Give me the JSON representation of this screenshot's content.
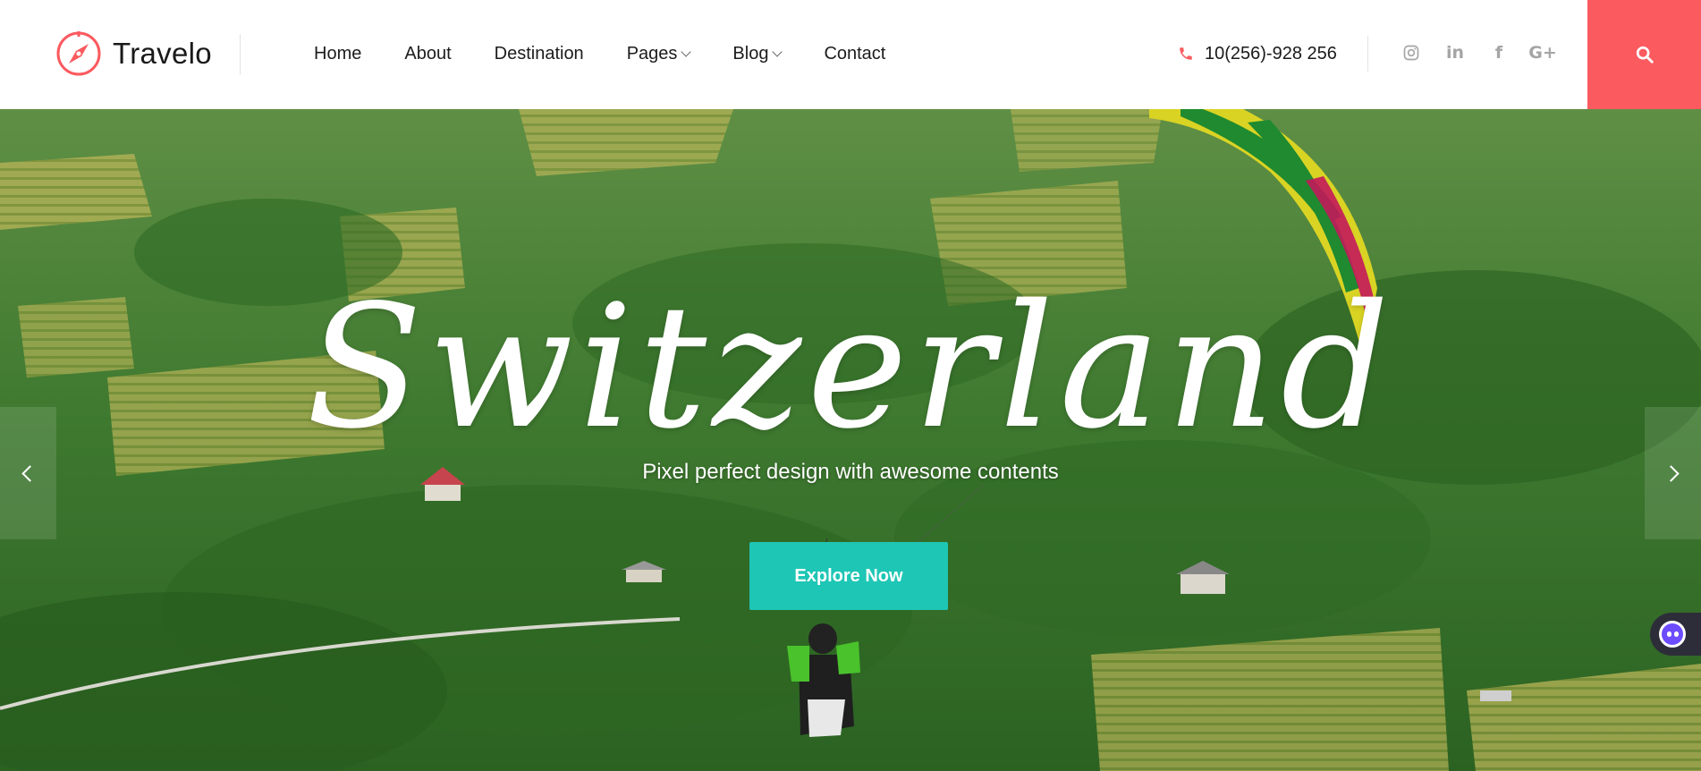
{
  "brand": {
    "name": "Travelo",
    "logo_icon": "compass-icon",
    "accent": "#fb5a5f"
  },
  "nav": {
    "items": [
      {
        "label": "Home",
        "dropdown": false
      },
      {
        "label": "About",
        "dropdown": false
      },
      {
        "label": "Destination",
        "dropdown": false
      },
      {
        "label": "Pages",
        "dropdown": true
      },
      {
        "label": "Blog",
        "dropdown": true
      },
      {
        "label": "Contact",
        "dropdown": false
      }
    ]
  },
  "contact": {
    "phone_icon": "phone-icon",
    "phone": "10(256)-928 256"
  },
  "socials": [
    {
      "name": "instagram-icon"
    },
    {
      "name": "linkedin-icon",
      "glyph": "in"
    },
    {
      "name": "facebook-icon",
      "glyph": "f"
    },
    {
      "name": "google-plus-icon",
      "glyph": "G+"
    }
  ],
  "search": {
    "icon": "search-icon"
  },
  "hero": {
    "title": "Switzerland",
    "subtitle": "Pixel perfect design with awesome contents",
    "cta_label": "Explore Now",
    "cta_color": "#1ec6b5"
  },
  "slider": {
    "prev_icon": "chevron-left-icon",
    "next_icon": "chevron-right-icon"
  },
  "chat": {
    "icon": "chat-bot-icon"
  }
}
